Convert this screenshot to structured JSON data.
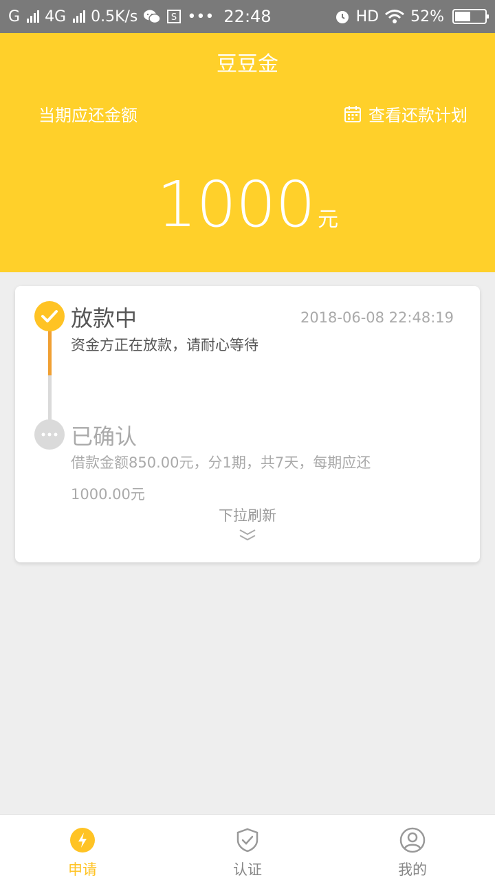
{
  "status_bar": {
    "carrier1": "G",
    "carrier2": "4G",
    "speed": "0.5K/s",
    "time": "22:48",
    "hd": "HD",
    "battery_pct": "52%",
    "battery_level": 0.52
  },
  "header": {
    "title": "豆豆金",
    "due_label": "当期应还金额",
    "plan_link": "查看还款计划",
    "amount": "1000",
    "unit": "元"
  },
  "timeline": {
    "steps": [
      {
        "title": "放款中",
        "time": "2018-06-08 22:48:19",
        "desc": "资金方正在放款，请耐心等待",
        "state": "active"
      },
      {
        "title": "已确认",
        "desc": "借款金额850.00元，分1期，共7天，每期应还1000.00元",
        "state": "pending"
      }
    ],
    "refresh_hint": "下拉刷新"
  },
  "nav": {
    "items": [
      {
        "label": "申请",
        "icon": "lightning-icon",
        "active": true
      },
      {
        "label": "认证",
        "icon": "shield-check-icon",
        "active": false
      },
      {
        "label": "我的",
        "icon": "user-icon",
        "active": false
      }
    ]
  },
  "colors": {
    "brand_yellow": "#FFD02A",
    "accent_yellow": "#FFC324",
    "progress_orange": "#F0A033",
    "muted_gray": "#AAAAAA"
  }
}
